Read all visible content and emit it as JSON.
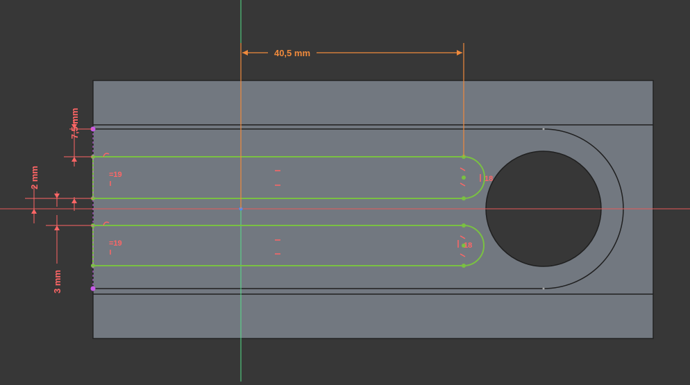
{
  "app": {
    "background": "#373737",
    "part_color": "#727880",
    "sketch_color": "#7ac142",
    "dimension_color": "#f08a3c",
    "constraint_color": "#ff6666",
    "axis_h_color": "#e85a5a",
    "axis_v_color": "#55e08a"
  },
  "dimensions": {
    "horizontal": "40,5 mm",
    "top_offset": "7,5 mm",
    "center_gap": "2 mm",
    "bottom_offset": "3 mm"
  },
  "constraints": {
    "upper_left_label": "=19",
    "lower_left_label": "=19",
    "upper_arc_label": "18",
    "lower_arc_label": "18"
  }
}
